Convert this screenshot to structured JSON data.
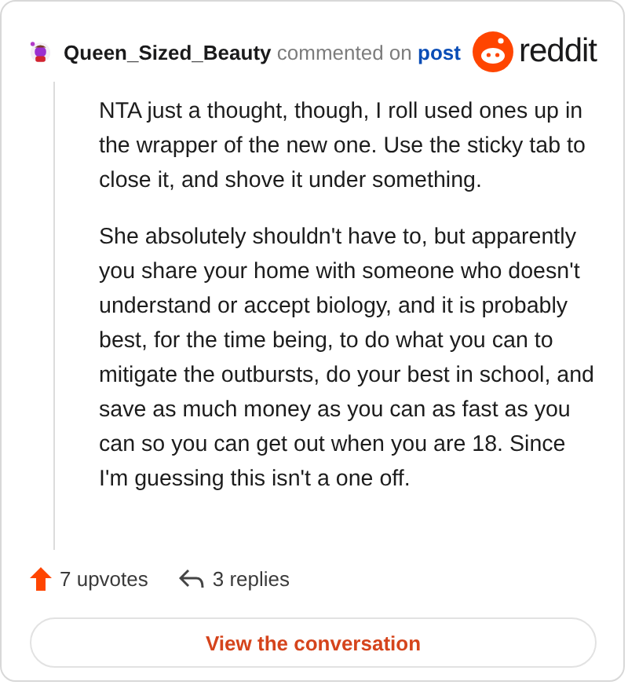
{
  "comment": {
    "author": "Queen_Sized_Beauty",
    "action": "commented on",
    "link": "post",
    "brand": "reddit",
    "paragraphs": [
      "NTA just a thought, though, I roll used ones up in the wrapper of the new one. Use the sticky tab to close it, and shove it under something.",
      "She absolutely shouldn't have to, but apparently you share your home with someone who doesn't understand or accept biology, and it is probably best, for the time being, to do what you can to mitigate the outbursts, do your best in school, and save as much money as you can as fast as you can so you can get out when you are 18. Since I'm guessing this isn't a one off."
    ],
    "upvotes": "7 upvotes",
    "replies": "3 replies",
    "button": "View the conversation"
  }
}
